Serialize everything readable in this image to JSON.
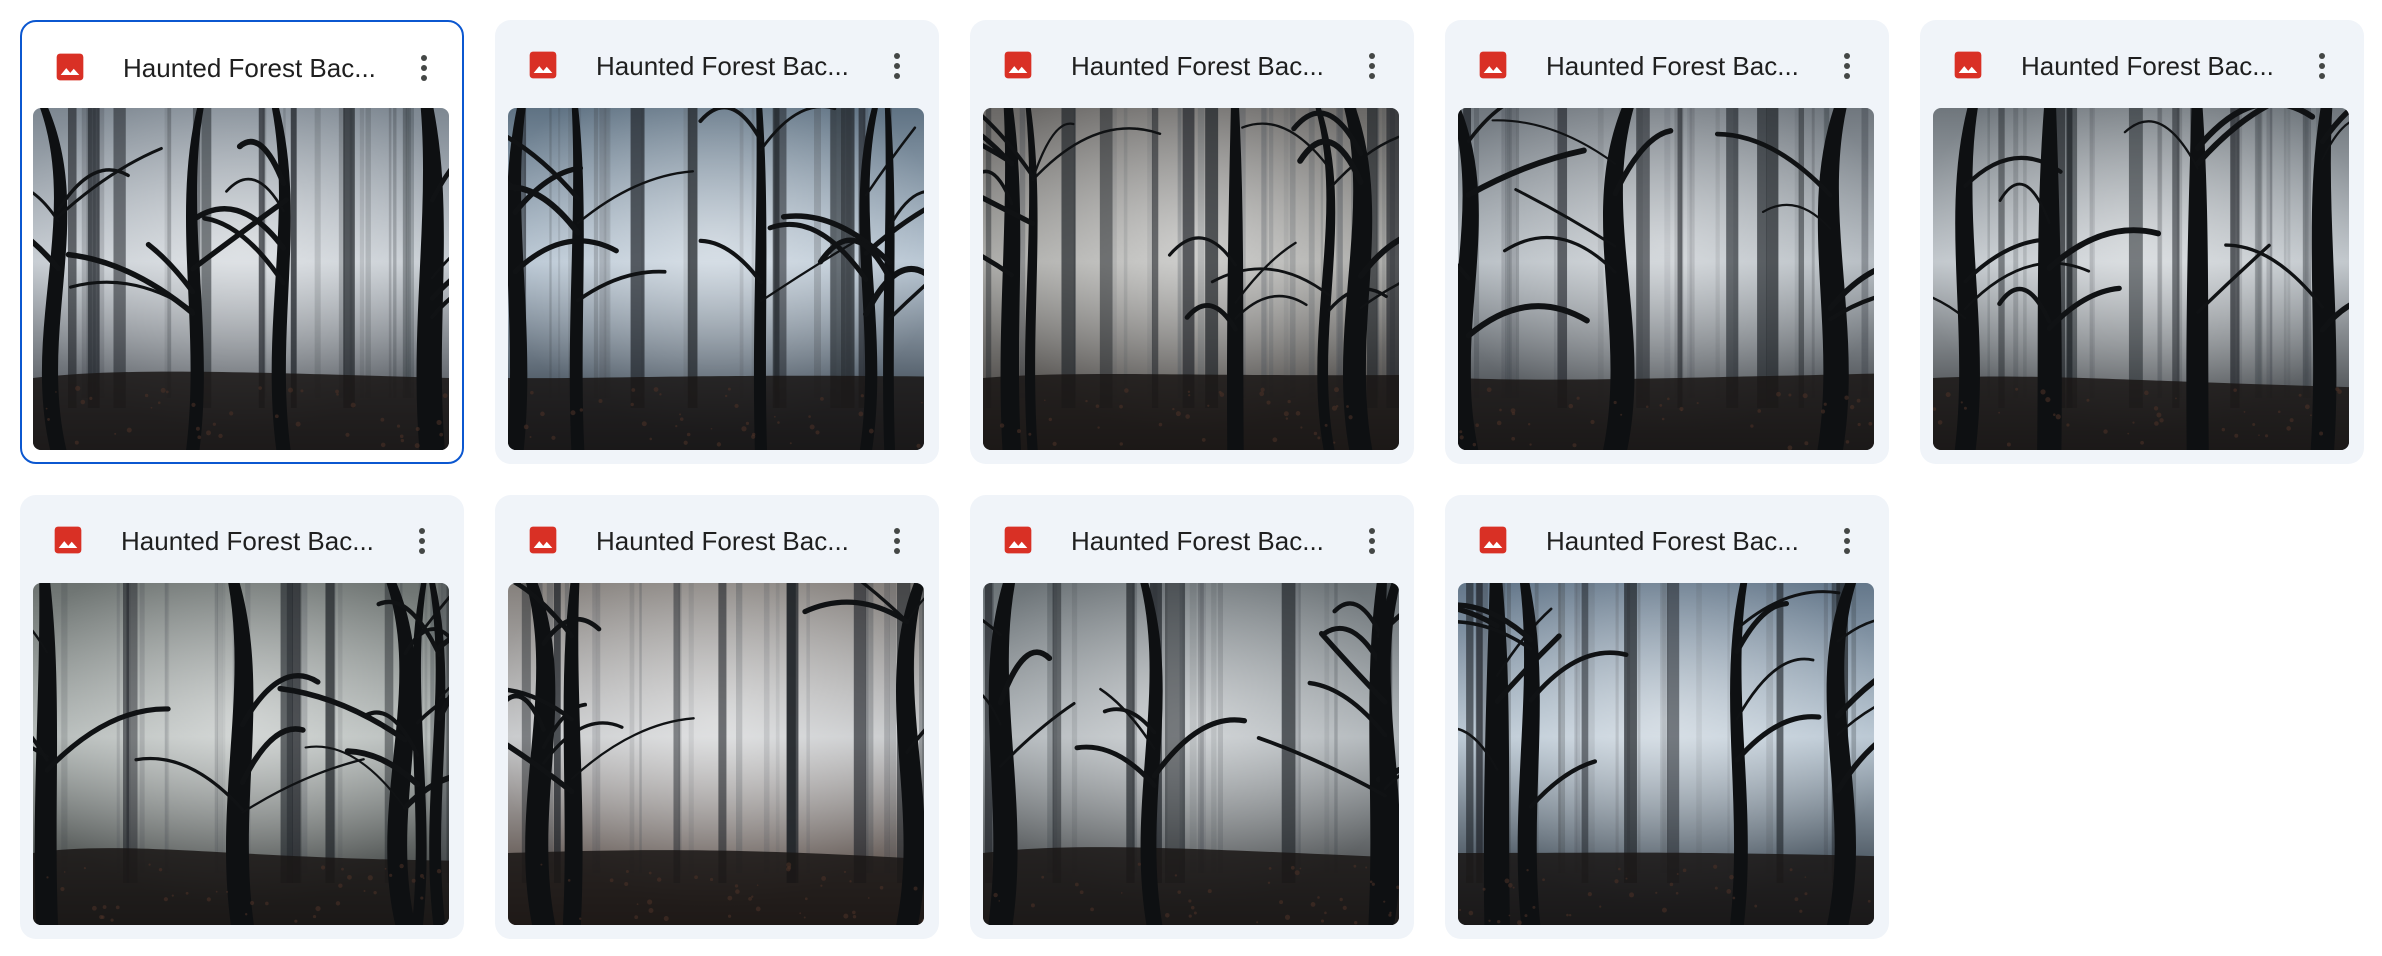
{
  "files": [
    {
      "name": "Haunted Forest Bac...",
      "icon": "image-file-icon",
      "selected": true
    },
    {
      "name": "Haunted Forest Bac...",
      "icon": "image-file-icon",
      "selected": false
    },
    {
      "name": "Haunted Forest Bac...",
      "icon": "image-file-icon",
      "selected": false
    },
    {
      "name": "Haunted Forest Bac...",
      "icon": "image-file-icon",
      "selected": false
    },
    {
      "name": "Haunted Forest Bac...",
      "icon": "image-file-icon",
      "selected": false
    },
    {
      "name": "Haunted Forest Bac...",
      "icon": "image-file-icon",
      "selected": false
    },
    {
      "name": "Haunted Forest Bac...",
      "icon": "image-file-icon",
      "selected": false
    },
    {
      "name": "Haunted Forest Bac...",
      "icon": "image-file-icon",
      "selected": false
    },
    {
      "name": "Haunted Forest Bac...",
      "icon": "image-file-icon",
      "selected": false
    }
  ],
  "colors": {
    "card_background": "#f0f4f9",
    "selected_border": "#0b57d0",
    "image_icon": "#d93025",
    "title_text": "#1f1f1f",
    "more_icon": "#444746"
  }
}
